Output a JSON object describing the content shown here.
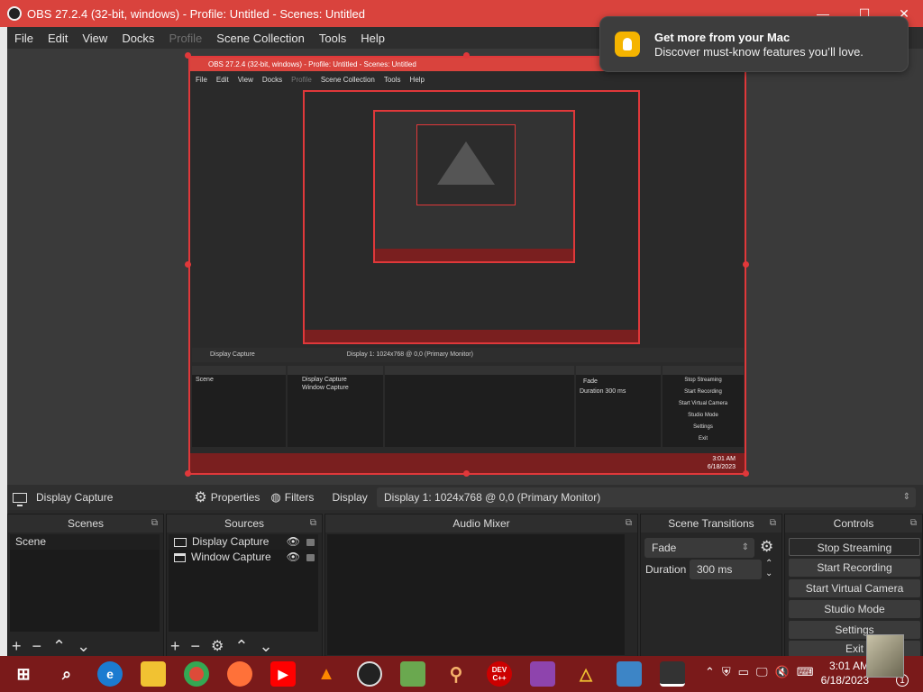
{
  "window": {
    "title": "OBS 27.2.4 (32-bit, windows) - Profile: Untitled - Scenes: Untitled",
    "minimize": "—",
    "maximize": "☐",
    "close": "✕"
  },
  "menu": {
    "items": [
      "File",
      "Edit",
      "View",
      "Docks",
      "Profile",
      "Scene Collection",
      "Tools",
      "Help"
    ],
    "disabled": [
      "Profile"
    ]
  },
  "preview": {
    "inner_title": "OBS 27.2.4 (32-bit, windows) - Profile: Untitled - Scenes: Untitled",
    "inner_menu": [
      "File",
      "Edit",
      "View",
      "Docks",
      "Profile",
      "Scene Collection",
      "Tools",
      "Help"
    ],
    "inner_source": "Display Capture",
    "inner_display": "Display 1: 1024x768 @ 0,0 (Primary Monitor)",
    "inner_docks": [
      "Scenes",
      "Sources",
      "Audio Mixer",
      "Scene Transitions",
      "Controls"
    ],
    "inner_scene": "Scene",
    "inner_sources": [
      "Display Capture",
      "Window Capture"
    ],
    "inner_fade": "Fade",
    "inner_duration_label": "Duration",
    "inner_duration": "300 ms",
    "inner_controls": [
      "Stop Streaming",
      "Start Recording",
      "Start Virtual Camera",
      "Studio Mode",
      "Settings",
      "Exit"
    ],
    "inner_time": "3:01 AM",
    "inner_date": "6/18/2023"
  },
  "source_toolbar": {
    "source_name": "Display Capture",
    "properties": "Properties",
    "filters": "Filters",
    "display_label": "Display",
    "display_value": "Display 1: 1024x768 @ 0,0 (Primary Monitor)"
  },
  "docks": {
    "scenes": {
      "title": "Scenes",
      "items": [
        "Scene"
      ]
    },
    "sources": {
      "title": "Sources",
      "items": [
        "Display Capture",
        "Window Capture"
      ]
    },
    "audio": {
      "title": "Audio Mixer"
    },
    "transitions": {
      "title": "Scene Transitions",
      "transition": "Fade",
      "duration_label": "Duration",
      "duration": "300 ms"
    },
    "controls": {
      "title": "Controls",
      "buttons": [
        "Stop Streaming",
        "Start Recording",
        "Start Virtual Camera",
        "Studio Mode",
        "Settings",
        "Exit"
      ]
    }
  },
  "notification": {
    "title": "Get more from your Mac",
    "body": "Discover must-know features you’ll love."
  },
  "taskbar": {
    "icons": [
      "windows-start",
      "search",
      "edge",
      "file-explorer",
      "chrome",
      "firefox",
      "youtube",
      "vlc",
      "obs",
      "notepad",
      "search-tool",
      "devcpp",
      "winrar",
      "vectorworks",
      "virtualbox",
      "obs-active"
    ],
    "devcpp_label": "DEV C++",
    "time": "3:01 AM",
    "date": "6/18/2023",
    "notification_count": "1"
  },
  "colors": {
    "accent": "#d9433d",
    "taskbar": "#7a1a1a",
    "panel": "#262626"
  }
}
